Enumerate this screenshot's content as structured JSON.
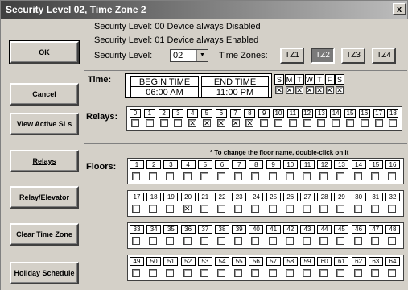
{
  "window": {
    "title": "Security Level 02, Time Zone 2",
    "close_label": "x"
  },
  "sidebar": {
    "buttons": [
      "OK",
      "Cancel",
      "View Active SLs",
      "Relays",
      "Relay/Elevator",
      "Clear Time Zone",
      "Holiday Schedule"
    ]
  },
  "security": {
    "line1": "Security Level:  00 Device always Disabled",
    "line2": "Security Level:  01 Device always Enabled",
    "label": "Security Level:",
    "selected_value": "02",
    "timezones_label": "Time Zones:",
    "timezones": [
      "TZ1",
      "TZ2",
      "TZ3",
      "TZ4"
    ],
    "active_timezone": "TZ2"
  },
  "time": {
    "label": "Time:",
    "begin_header": "BEGIN TIME",
    "end_header": "END TIME",
    "begin_value": "06:00 AM",
    "end_value": "11:00 PM",
    "days": [
      "S",
      "M",
      "T",
      "W",
      "T",
      "F",
      "S"
    ],
    "days_checked": [
      true,
      true,
      true,
      true,
      true,
      true,
      true
    ]
  },
  "relays": {
    "label": "Relays:",
    "numbers": [
      "0",
      "1",
      "2",
      "3",
      "4",
      "5",
      "6",
      "7",
      "8",
      "9",
      "10",
      "11",
      "12",
      "13",
      "14",
      "15",
      "16",
      "17",
      "18"
    ],
    "checked": [
      false,
      false,
      false,
      false,
      true,
      true,
      true,
      true,
      true,
      false,
      false,
      false,
      false,
      false,
      false,
      false,
      false,
      false,
      false
    ]
  },
  "floors": {
    "label": "Floors:",
    "hint": "* To change the floor name, double-click on it",
    "rows": [
      {
        "numbers": [
          "1",
          "2",
          "3",
          "4",
          "5",
          "6",
          "7",
          "8",
          "9",
          "10",
          "11",
          "12",
          "13",
          "14",
          "15",
          "16"
        ],
        "checked": [
          false,
          false,
          false,
          false,
          false,
          false,
          false,
          false,
          false,
          false,
          false,
          false,
          false,
          false,
          false,
          false
        ]
      },
      {
        "numbers": [
          "17",
          "18",
          "19",
          "20",
          "21",
          "22",
          "23",
          "24",
          "25",
          "26",
          "27",
          "28",
          "29",
          "30",
          "31",
          "32"
        ],
        "checked": [
          false,
          false,
          false,
          true,
          false,
          false,
          false,
          false,
          false,
          false,
          false,
          false,
          false,
          false,
          false,
          false
        ]
      },
      {
        "numbers": [
          "33",
          "34",
          "35",
          "36",
          "37",
          "38",
          "39",
          "40",
          "41",
          "42",
          "43",
          "44",
          "45",
          "46",
          "47",
          "48"
        ],
        "checked": [
          false,
          false,
          false,
          false,
          false,
          false,
          false,
          false,
          false,
          false,
          false,
          false,
          false,
          false,
          false,
          false
        ]
      },
      {
        "numbers": [
          "49",
          "50",
          "51",
          "52",
          "53",
          "54",
          "55",
          "56",
          "57",
          "58",
          "59",
          "60",
          "61",
          "62",
          "63",
          "64"
        ],
        "checked": [
          false,
          false,
          false,
          false,
          false,
          false,
          false,
          false,
          false,
          false,
          false,
          false,
          false,
          false,
          false,
          false
        ]
      }
    ]
  }
}
